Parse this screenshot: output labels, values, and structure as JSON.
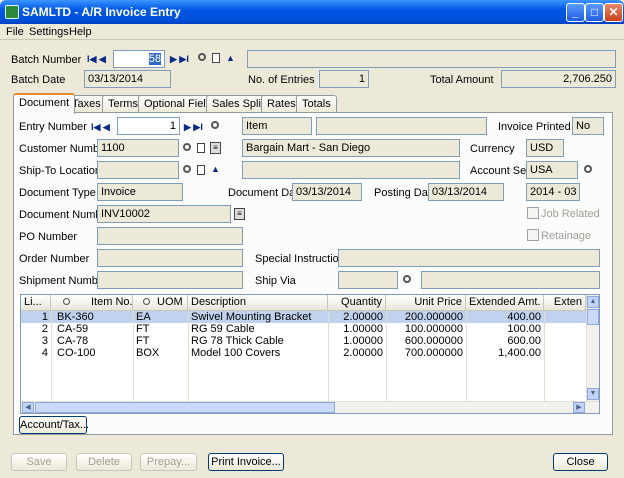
{
  "window": {
    "title": "SAMLTD - A/R Invoice Entry",
    "min": "_",
    "max": "□",
    "close": "✕"
  },
  "menu": [
    "File",
    "Settings",
    "Help"
  ],
  "batch": {
    "number_label": "Batch Number",
    "number_value": "58",
    "date_label": "Batch Date",
    "date_value": "03/13/2014",
    "entries_label": "No. of Entries",
    "entries_value": "1",
    "total_label": "Total Amount",
    "total_value": "2,706.250"
  },
  "tabs": [
    "Document",
    "Taxes",
    "Terms",
    "Optional Fields",
    "Sales Split",
    "Rates",
    "Totals"
  ],
  "document": {
    "entry_number_label": "Entry Number",
    "entry_number_value": "1",
    "item_value": "Item",
    "invoice_printed_label": "Invoice Printed",
    "invoice_printed_value": "No",
    "customer_label": "Customer Number",
    "customer_value": "1100",
    "customer_name": "Bargain Mart - San Diego",
    "currency_label": "Currency",
    "currency_value": "USD",
    "shipto_label": "Ship-To Location",
    "account_set_label": "Account Set",
    "account_set_value": "USA",
    "doctype_label": "Document Type",
    "doctype_value": "Invoice",
    "docdate_label": "Document Date",
    "docdate_value": "03/13/2014",
    "postdate_label": "Posting Date",
    "postdate_value": "03/13/2014",
    "period_value": "2014 - 03",
    "docnum_label": "Document Number",
    "docnum_value": "INV10002",
    "job_related_label": "Job Related",
    "po_label": "PO Number",
    "retainage_label": "Retainage",
    "order_label": "Order Number",
    "special_label": "Special Instructions",
    "shipment_label": "Shipment Number",
    "shipvia_label": "Ship Via"
  },
  "grid": {
    "headers": [
      "Li...",
      "Item No.",
      "UOM",
      "Description",
      "Quantity",
      "Unit Price",
      "Extended Amt.",
      "Exten"
    ],
    "rows": [
      [
        "1",
        "BK-360",
        "EA",
        "Swivel Mounting Bracket",
        "2.00000",
        "200.000000",
        "400.00"
      ],
      [
        "2",
        "CA-59",
        "FT",
        "RG 59 Cable",
        "1.00000",
        "100.000000",
        "100.00"
      ],
      [
        "3",
        "CA-78",
        "FT",
        "RG 78 Thick Cable",
        "1.00000",
        "600.000000",
        "600.00"
      ],
      [
        "4",
        "CO-100",
        "BOX",
        "Model 100 Covers",
        "2.00000",
        "700.000000",
        "1,400.00"
      ]
    ]
  },
  "buttons": {
    "account_tax": "Account/Tax...",
    "save": "Save",
    "delete": "Delete",
    "prepay": "Prepay...",
    "print": "Print Invoice...",
    "close": "Close"
  },
  "colors": {
    "titlebar": "#0058e6",
    "tab_highlight": "#e68b2c",
    "selection": "#316ac5"
  }
}
